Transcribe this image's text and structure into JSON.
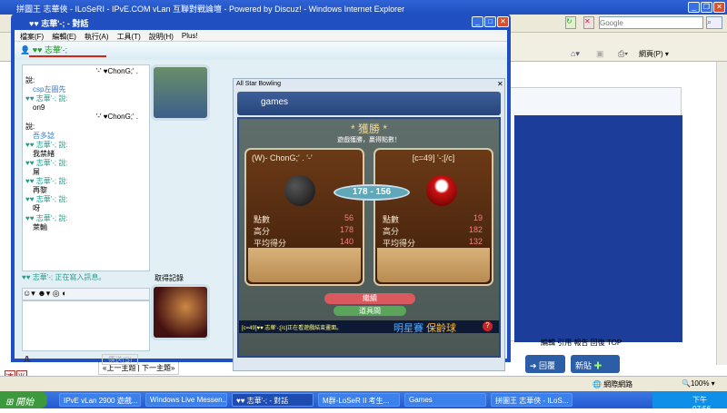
{
  "ie": {
    "title": "拼圖王 志華俠 - ILoSeRI - IPvE.COM vLan 互聯對戰論壇 - Powered by Discuz! - Windows Internet Explorer",
    "search_placeholder": "Google",
    "page_menu": "網頁(P)",
    "zoom": "100%",
    "zone": "網際網路"
  },
  "page": {
    "actions": "編輯 引用 報告 回復 TOP",
    "reply_button": "回覆",
    "newpost_button": "新貼",
    "prev_next": "«上一主題 | 下一主題»",
    "fast_reply": [
      "速",
      "半"
    ]
  },
  "messenger": {
    "title": "♥♥ 志華'-; - 對話",
    "menu": [
      "檔案(F)",
      "編輯(E)",
      "執行(A)",
      "工具(T)",
      "說明(H)",
      "Plus!"
    ],
    "contact_name": "♥♥ 志華'-;",
    "chat": [
      {
        "type": "name",
        "text": "'-' ♥ChonG;' .",
        "alt": true
      },
      {
        "type": "said",
        "text": "說:"
      },
      {
        "type": "msg",
        "text": "csp左圖先",
        "blue": true
      },
      {
        "type": "name",
        "text": "♥♥ 志華'-; 說:"
      },
      {
        "type": "msg",
        "text": "on9"
      },
      {
        "type": "name",
        "text": "'-' ♥ChonG;' .",
        "alt": true
      },
      {
        "type": "said",
        "text": "說:"
      },
      {
        "type": "msg",
        "text": "吾多諗",
        "blue": true
      },
      {
        "type": "name",
        "text": "♥♥ 志華'-; 說:"
      },
      {
        "type": "msg",
        "text": "我禁緒"
      },
      {
        "type": "name",
        "text": "♥♥ 志華'-; 說:"
      },
      {
        "type": "msg",
        "text": "屌"
      },
      {
        "type": "name",
        "text": "♥♥ 志華'-; 說:"
      },
      {
        "type": "msg",
        "text": "再黎"
      },
      {
        "type": "name",
        "text": "♥♥ 志華'-; 說:"
      },
      {
        "type": "msg",
        "text": "呀"
      },
      {
        "type": "name",
        "text": "♥♥ 志華'-; 說:"
      },
      {
        "type": "msg",
        "text": "萊輸"
      }
    ],
    "typing": "♥♥ 志華'-; 正在寫入訊息。",
    "send_button": "傳送(S)",
    "avatar_label": "取得記錄"
  },
  "game": {
    "window_title": "All Star Bowling",
    "header": "games",
    "result_title": "* 獲勝 *",
    "result_sub": "遊戲獲勝，贏得點數！",
    "score": "178 - 156",
    "players": [
      {
        "name": "(W)- ChonG;' .  '-'",
        "stats": [
          {
            "label": "點數",
            "value": "56"
          },
          {
            "label": "高分",
            "value": "178"
          },
          {
            "label": "平均得分",
            "value": "140"
          }
        ],
        "ball_color": "#1a1a1a"
      },
      {
        "name": "[c=49] '-;[/c]",
        "stats": [
          {
            "label": "點數",
            "value": "19"
          },
          {
            "label": "高分",
            "value": "182"
          },
          {
            "label": "平均得分",
            "value": "132"
          }
        ],
        "ball_color": "#b01010"
      }
    ],
    "continue_button": "繼續",
    "shop_button": "道具間",
    "status": "[c=49]♥♥ 志華'-;[/c]正在看遊戲結束畫面。",
    "brand": [
      "明星賽",
      "保齡球"
    ]
  },
  "taskbar": {
    "start": "開始",
    "items": [
      "IPvE vLan 2900 遊戲...",
      "Windows Live Messen...",
      "♥♥ 志華'-; - 對話",
      "M群-LoSeR II 考生...",
      "Games",
      "拼圖王 志華俠 - ILoS..."
    ],
    "clock": "下午 07:56"
  }
}
